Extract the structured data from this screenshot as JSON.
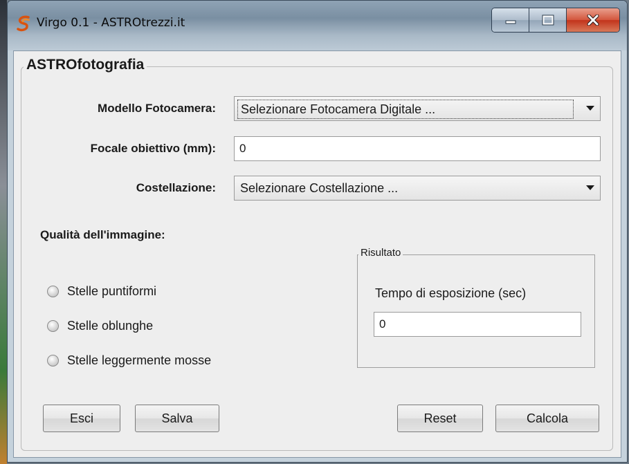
{
  "window": {
    "title": "Virgo 0.1 - ASTROtrezzi.it",
    "controls": {
      "minimize": "minimize",
      "maximize": "maximize",
      "close": "close"
    }
  },
  "panel": {
    "title": "ASTROfotografia"
  },
  "form": {
    "camera_label": "Modello Fotocamera:",
    "camera_value": "Selezionare Fotocamera Digitale ...",
    "focal_label": "Focale obiettivo (mm):",
    "focal_value": "0",
    "constellation_label": "Costellazione:",
    "constellation_value": "Selezionare Costellazione ..."
  },
  "quality": {
    "label": "Qualità dell'immagine:",
    "options": [
      {
        "label": "Stelle puntiformi",
        "checked": false
      },
      {
        "label": "Stelle oblunghe",
        "checked": false
      },
      {
        "label": "Stelle leggermente mosse",
        "checked": false
      }
    ]
  },
  "result": {
    "title": "Risultato",
    "caption": "Tempo di esposizione (sec)",
    "value": "0"
  },
  "buttons": {
    "exit": "Esci",
    "save": "Salva",
    "reset": "Reset",
    "calculate": "Calcola"
  },
  "colors": {
    "accent_close": "#c2331b",
    "panel_bg": "#eeeeee",
    "frame": "#b7c6d2"
  }
}
